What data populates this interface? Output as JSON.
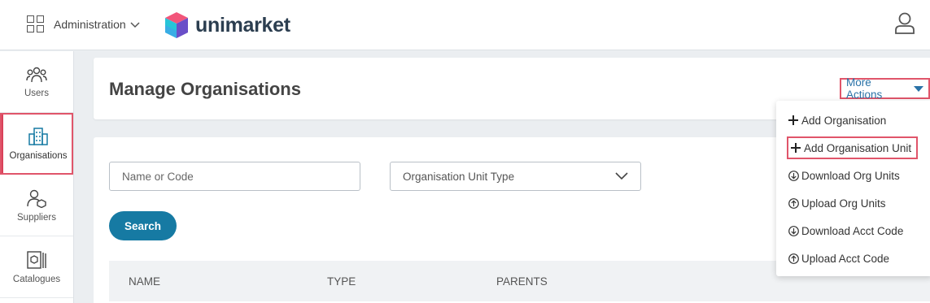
{
  "topbar": {
    "app_switcher_label": "Administration",
    "logo_text": "unimarket"
  },
  "sidebar": {
    "items": [
      {
        "label": "Users",
        "icon": "users-icon"
      },
      {
        "label": "Organisations",
        "icon": "buildings-icon",
        "active": true
      },
      {
        "label": "Suppliers",
        "icon": "supplier-icon"
      },
      {
        "label": "Catalogues",
        "icon": "catalogue-icon"
      }
    ]
  },
  "header": {
    "title": "Manage Organisations",
    "more_actions_label": "More Actions"
  },
  "filters": {
    "name_placeholder": "Name or Code",
    "type_select_label": "Organisation Unit Type",
    "search_label": "Search"
  },
  "table": {
    "columns": [
      "NAME",
      "TYPE",
      "PARENTS"
    ]
  },
  "more_actions_menu": {
    "items": [
      {
        "label": "Add Organisation",
        "icon": "plus-icon"
      },
      {
        "label": "Add Organisation Unit",
        "icon": "plus-icon",
        "highlighted": true
      },
      {
        "label": "Download Org Units",
        "icon": "download-icon"
      },
      {
        "label": "Upload Org Units",
        "icon": "upload-icon"
      },
      {
        "label": "Download Acct Code",
        "icon": "download-icon"
      },
      {
        "label": "Upload Acct Code",
        "icon": "upload-icon"
      }
    ]
  },
  "colors": {
    "accent_blue": "#167aa3",
    "link_blue": "#2a72a7",
    "highlight_red": "#e0556a"
  }
}
